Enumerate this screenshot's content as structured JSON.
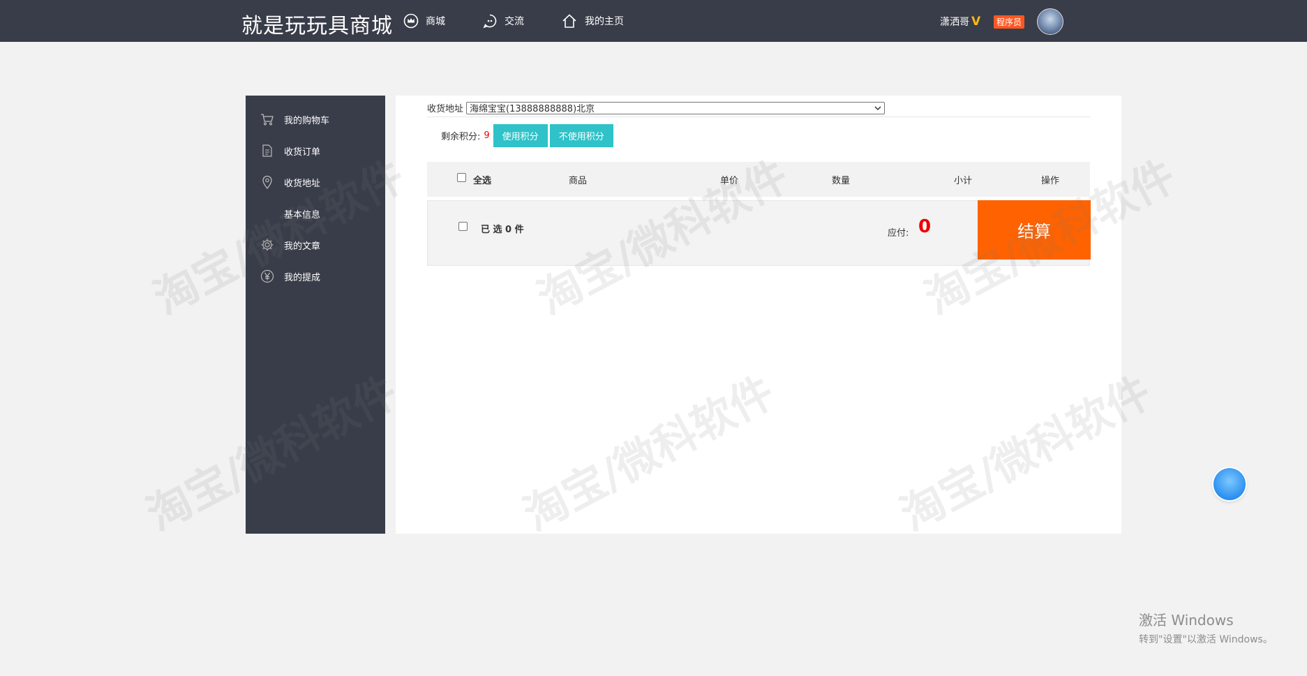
{
  "header": {
    "brand": "就是玩玩具商城",
    "nav": [
      {
        "label": "商城",
        "icon": "crown-icon"
      },
      {
        "label": "交流",
        "icon": "chat-icon"
      },
      {
        "label": "我的主页",
        "icon": "home-icon"
      }
    ],
    "user": {
      "name": "潇洒哥",
      "vip": "V",
      "role": "程序员"
    }
  },
  "sidebar": {
    "items": [
      {
        "label": "我的购物车",
        "icon": "cart-icon"
      },
      {
        "label": "收货订单",
        "icon": "document-icon"
      },
      {
        "label": "收货地址",
        "icon": "location-pin-icon"
      },
      {
        "label": "基本信息",
        "icon": ""
      },
      {
        "label": "我的文章",
        "icon": "gear-icon"
      },
      {
        "label": "我的提成",
        "icon": "yen-icon"
      }
    ]
  },
  "main": {
    "address": {
      "label": "收货地址",
      "selected": "海绵宝宝(13888888888)北京"
    },
    "points": {
      "label": "剩余积分:",
      "value": "9",
      "use_label": "使用积分",
      "no_use_label": "不使用积分"
    },
    "table": {
      "select_all": "全选",
      "columns": [
        "商品",
        "单价",
        "数量",
        "小计",
        "操作"
      ]
    },
    "footer": {
      "selected_text": "已 选 0 件",
      "due_label": "应付:",
      "due_amount": "0",
      "checkout_label": "结算"
    }
  },
  "watermark": "淘宝/微科软件",
  "windows_activation": {
    "title": "激活 Windows",
    "subtitle": "转到\"设置\"以激活 Windows。"
  },
  "colors": {
    "header_bg": "#393d49",
    "teal_button": "#2fc2c8",
    "checkout": "#ff6201",
    "price_red": "#e00000",
    "badge": "#ff5722"
  }
}
